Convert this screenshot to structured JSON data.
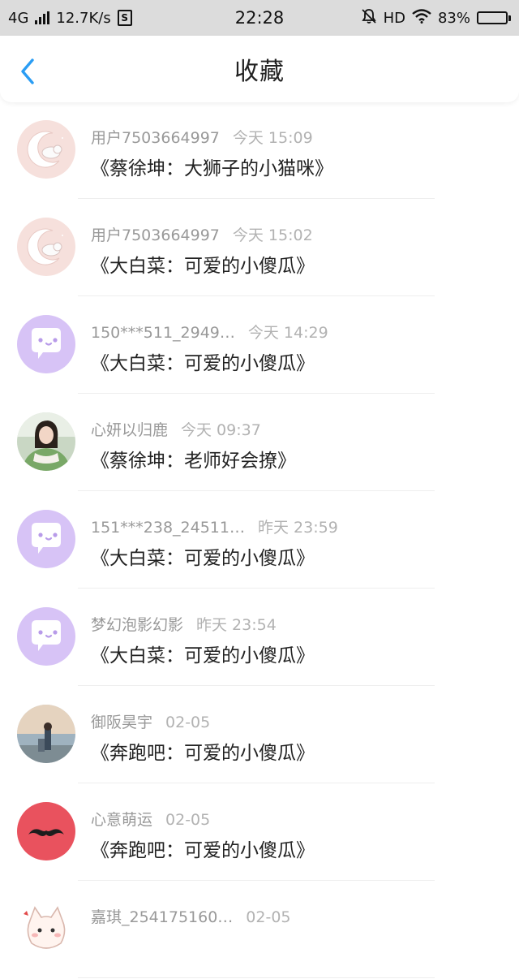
{
  "status_bar": {
    "network": "4G",
    "speed": "12.7K/s",
    "sync_icon_label": "S",
    "time": "22:28",
    "hd": "HD",
    "battery_percent": "83%",
    "battery_level": 0.83
  },
  "header": {
    "title": "收藏",
    "accent_color": "#2a9df4"
  },
  "items": [
    {
      "user": "用户7503664997",
      "time": "今天 15:09",
      "title": "《蔡徐坤：大狮子的小猫咪》",
      "avatar": "moon-cat-avatar"
    },
    {
      "user": "用户7503664997",
      "time": "今天 15:02",
      "title": "《大白菜：可爱的小傻瓜》",
      "avatar": "moon-cat-avatar"
    },
    {
      "user": "150***511_2949…",
      "time": "今天 14:29",
      "title": "《大白菜：可爱的小傻瓜》",
      "avatar": "chat-bubble-avatar"
    },
    {
      "user": "心妍以归鹿",
      "time": "今天 09:37",
      "title": "《蔡徐坤：老师好会撩》",
      "avatar": "photo-girl-avatar"
    },
    {
      "user": "151***238_24511…",
      "time": "昨天 23:59",
      "title": "《大白菜：可爱的小傻瓜》",
      "avatar": "chat-bubble-avatar"
    },
    {
      "user": "梦幻泡影幻影",
      "time": "昨天 23:54",
      "title": "《大白菜：可爱的小傻瓜》",
      "avatar": "chat-bubble-avatar"
    },
    {
      "user": "御阪昊宇",
      "time": "02-05",
      "title": "《奔跑吧：可爱的小傻瓜》",
      "avatar": "photo-scenery-avatar"
    },
    {
      "user": "心意萌运",
      "time": "02-05",
      "title": "《奔跑吧：可爱的小傻瓜》",
      "avatar": "mustache-avatar"
    },
    {
      "user": "嘉琪_254175160…",
      "time": "02-05",
      "title": "",
      "avatar": "cartoon-cat-avatar"
    }
  ]
}
